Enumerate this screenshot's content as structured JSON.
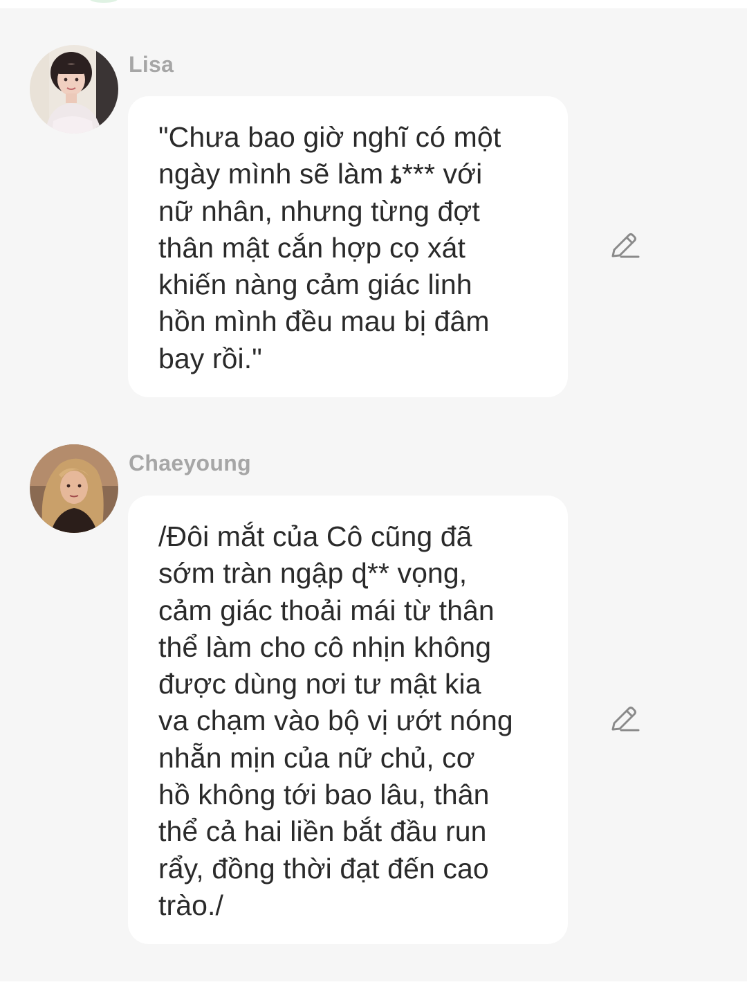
{
  "messages": [
    {
      "sender": "Lisa",
      "text": "\"Chưa bao giờ nghĩ có một\nngày mình sẽ làm ȶ*** với\nnữ nhân, nhưng từng đợt\nthân mật  cắn hợp cọ xát\nkhiến nàng cảm giác linh\nhồn mình đều mau bị đâm\nbay rồi.\"",
      "avatar_icon": "user-avatar",
      "edit_icon": "pencil-edit-icon"
    },
    {
      "sender": "Chaeyoung",
      "text": "/Đôi mắt của Cô cũng đã\nsớm tràn ngập ɖ** vọng,\ncảm giác thoải mái từ thân\nthể làm cho cô nhịn không\nđược dùng nơi tư mật kia\nva chạm vào bộ vị ướt nóng\nnhẵn mịn của nữ chủ, cơ\nhồ không tới bao lâu, thân\nthể cả hai liền bắt đầu run\nrẩy, đồng thời đạt đến cao\ntrào./",
      "avatar_icon": "user-avatar",
      "edit_icon": "pencil-edit-icon"
    }
  ],
  "colors": {
    "background": "#f6f6f6",
    "bubble": "#ffffff",
    "sender_name": "#a6a6a6",
    "message_text": "#2a2a2a",
    "icon": "#8a8a8a"
  }
}
